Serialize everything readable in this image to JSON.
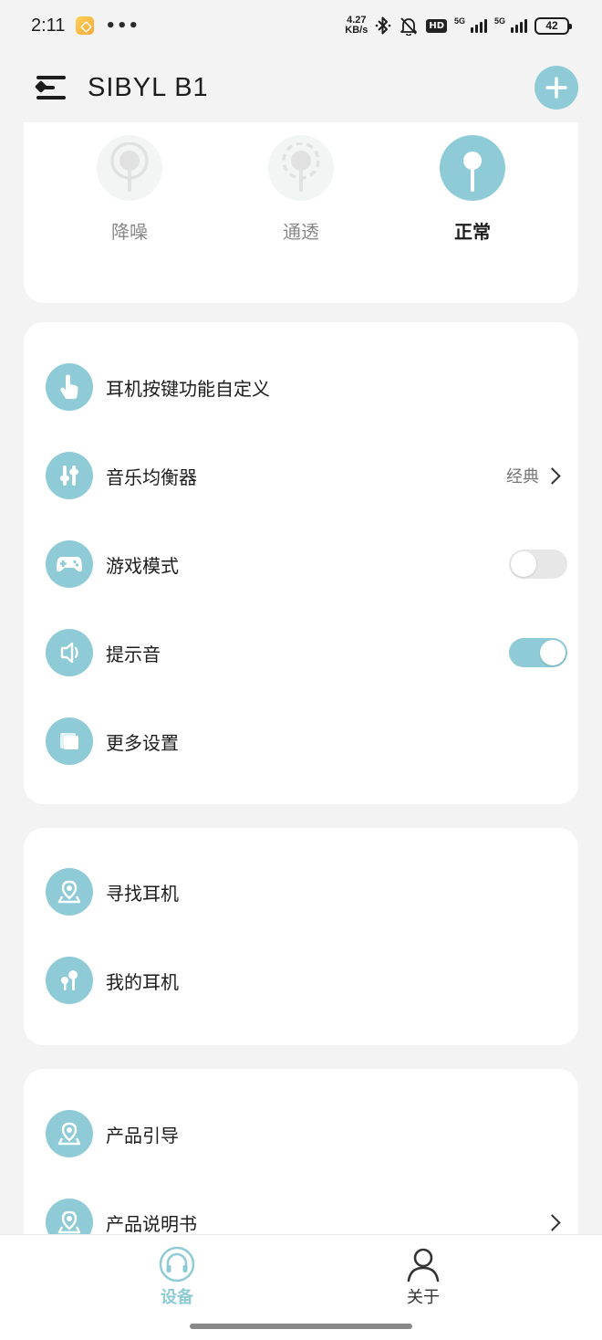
{
  "status_bar": {
    "time": "2:11",
    "more": "•••",
    "net_speed_value": "4.27",
    "net_speed_unit": "KB/s",
    "hd_badge": "HD",
    "signal1_label": "5G",
    "signal2_label": "5G",
    "battery": "42"
  },
  "header": {
    "title": "SIBYL B1"
  },
  "modes": [
    {
      "label": "降噪",
      "active": false
    },
    {
      "label": "通透",
      "active": false
    },
    {
      "label": "正常",
      "active": true
    }
  ],
  "settings": [
    {
      "label": "耳机按键功能自定义"
    },
    {
      "label": "音乐均衡器",
      "value": "经典"
    },
    {
      "label": "游戏模式",
      "toggle": false
    },
    {
      "label": "提示音",
      "toggle": true
    },
    {
      "label": "更多设置"
    }
  ],
  "find": [
    {
      "label": "寻找耳机"
    },
    {
      "label": "我的耳机"
    }
  ],
  "guide": [
    {
      "label": "产品引导"
    },
    {
      "label": "产品说明书"
    }
  ],
  "bottom_nav": [
    {
      "label": "设备",
      "active": true
    },
    {
      "label": "关于",
      "active": false
    }
  ],
  "colors": {
    "accent": "#8ecbd6",
    "background": "#f3f3f3",
    "card": "#ffffff",
    "toggle_off": "#e7e7e7"
  }
}
